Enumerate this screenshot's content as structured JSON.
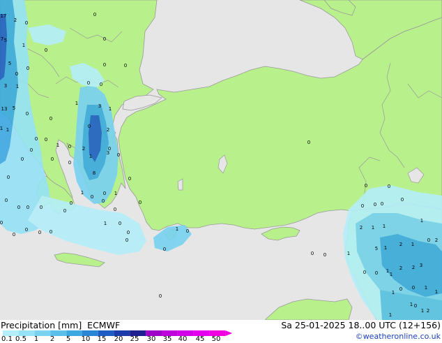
{
  "legend": {
    "title": "Precipitation [mm]",
    "model": "ECMWF",
    "datetime": "Sa 25-01-2025 18..00 UTC (12+156)",
    "credit": "©weatheronline.co.uk",
    "ticks": [
      "0.1",
      "0.5",
      "1",
      "2",
      "5",
      "10",
      "15",
      "20",
      "25",
      "30",
      "35",
      "40",
      "45",
      "50"
    ],
    "colors": [
      "#b4eefa",
      "#96e2f6",
      "#78d2f0",
      "#5ac0ea",
      "#3ca8e2",
      "#2a86d4",
      "#1e5ec4",
      "#1c3caa",
      "#1e2090",
      "#9e00c8",
      "#be00dc",
      "#d200e6",
      "#e600f0",
      "#f000e0"
    ]
  },
  "map": {
    "land_color": "#b8f08c",
    "sea_color": "#e6e6e6",
    "border_color": "#9a9a9a",
    "precip_labels": [
      {
        "t": "17"
      },
      {
        "t": "2"
      },
      {
        "t": "0"
      },
      {
        "t": "5"
      },
      {
        "t": "0"
      },
      {
        "t": "7"
      },
      {
        "t": "1"
      },
      {
        "t": "0"
      },
      {
        "t": "0"
      },
      {
        "t": "0"
      },
      {
        "t": "0"
      },
      {
        "t": "5"
      },
      {
        "t": "0"
      },
      {
        "t": "0"
      },
      {
        "t": "3"
      },
      {
        "t": "1"
      },
      {
        "t": "0"
      },
      {
        "t": "1"
      },
      {
        "t": "0"
      },
      {
        "t": "13"
      },
      {
        "t": "5"
      },
      {
        "t": "0"
      },
      {
        "t": "1"
      },
      {
        "t": "3"
      },
      {
        "t": "1"
      },
      {
        "t": "0"
      },
      {
        "t": "0"
      },
      {
        "t": "1"
      },
      {
        "t": "0"
      },
      {
        "t": "0"
      },
      {
        "t": "1"
      },
      {
        "t": "0"
      },
      {
        "t": "2"
      },
      {
        "t": "0"
      },
      {
        "t": "0"
      },
      {
        "t": "0"
      },
      {
        "t": "0"
      },
      {
        "t": "0"
      },
      {
        "t": "1"
      },
      {
        "t": "2"
      },
      {
        "t": "0"
      },
      {
        "t": "0"
      },
      {
        "t": "0"
      },
      {
        "t": "3"
      },
      {
        "t": "8"
      },
      {
        "t": "1"
      },
      {
        "t": "0"
      },
      {
        "t": "0"
      },
      {
        "t": "1"
      },
      {
        "t": "0"
      },
      {
        "t": "0"
      },
      {
        "t": "0"
      },
      {
        "t": "0"
      },
      {
        "t": "0"
      },
      {
        "t": "0"
      },
      {
        "t": "0"
      },
      {
        "t": "0"
      },
      {
        "t": "0"
      },
      {
        "t": "0"
      },
      {
        "t": "0"
      },
      {
        "t": "0"
      },
      {
        "t": "1"
      },
      {
        "t": "0"
      },
      {
        "t": "0"
      },
      {
        "t": "0"
      },
      {
        "t": "0"
      },
      {
        "t": "1"
      },
      {
        "t": "0"
      },
      {
        "t": "0"
      },
      {
        "t": "0"
      },
      {
        "t": "0"
      },
      {
        "t": "0"
      },
      {
        "t": "0"
      },
      {
        "t": "0"
      },
      {
        "t": "0"
      },
      {
        "t": "0"
      },
      {
        "t": "0"
      },
      {
        "t": "0"
      },
      {
        "t": "2"
      },
      {
        "t": "1"
      },
      {
        "t": "1"
      },
      {
        "t": "1"
      },
      {
        "t": "0"
      },
      {
        "t": "1"
      },
      {
        "t": "5"
      },
      {
        "t": "1"
      },
      {
        "t": "2"
      },
      {
        "t": "1"
      },
      {
        "t": "2"
      },
      {
        "t": "0"
      },
      {
        "t": "0"
      },
      {
        "t": "0"
      },
      {
        "t": "1"
      },
      {
        "t": "2"
      },
      {
        "t": "2"
      },
      {
        "t": "3"
      },
      {
        "t": "1"
      },
      {
        "t": "0"
      },
      {
        "t": "0"
      },
      {
        "t": "1"
      },
      {
        "t": "1"
      },
      {
        "t": "1"
      },
      {
        "t": "1"
      },
      {
        "t": "0"
      },
      {
        "t": "2"
      },
      {
        "t": "1"
      },
      {
        "t": "1"
      },
      {
        "t": "0"
      }
    ]
  }
}
